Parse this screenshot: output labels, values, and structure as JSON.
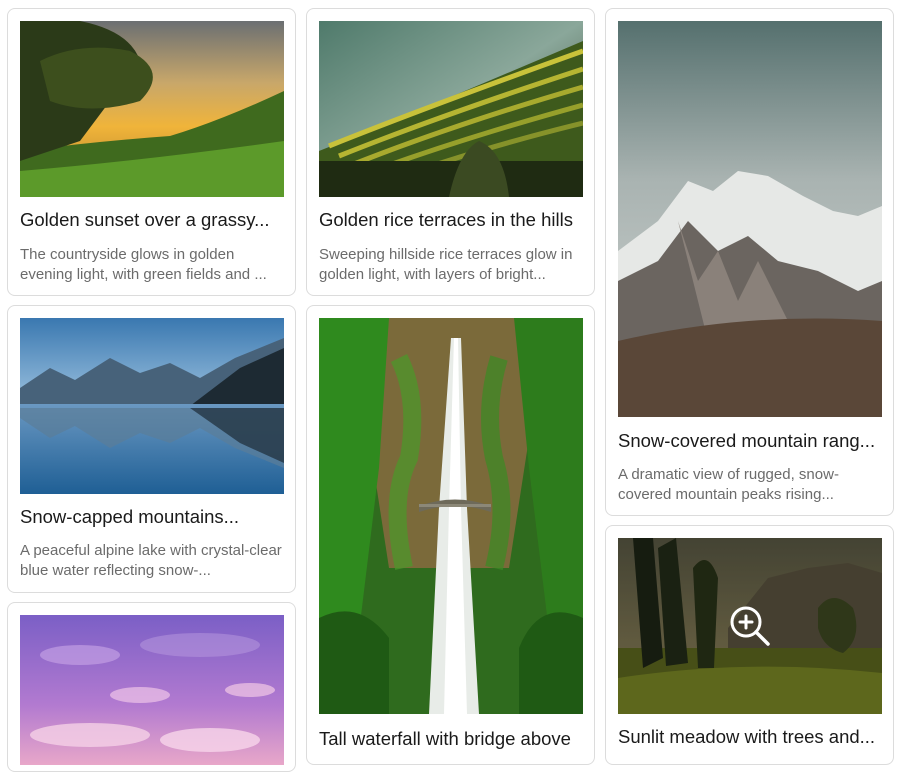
{
  "cards": [
    {
      "title": "Golden sunset over a grassy...",
      "description": "The countryside glows in golden evening light, with green fields and ..."
    },
    {
      "title": "Golden rice terraces in the hills",
      "description": "Sweeping hillside rice terraces glow in golden light, with layers of bright..."
    },
    {
      "title": "Snow-covered mountain rang...",
      "description": "A dramatic view of rugged, snow-covered mountain peaks rising..."
    },
    {
      "title": "Snow-capped mountains...",
      "description": "A peaceful alpine lake with crystal-clear blue water reflecting snow-..."
    },
    {
      "title": "Tall waterfall with bridge above",
      "description": ""
    },
    {
      "title": "Sunlit meadow with trees and...",
      "description": ""
    },
    {
      "title": "",
      "description": ""
    }
  ],
  "icons": {
    "zoom": "zoom-in-icon"
  }
}
